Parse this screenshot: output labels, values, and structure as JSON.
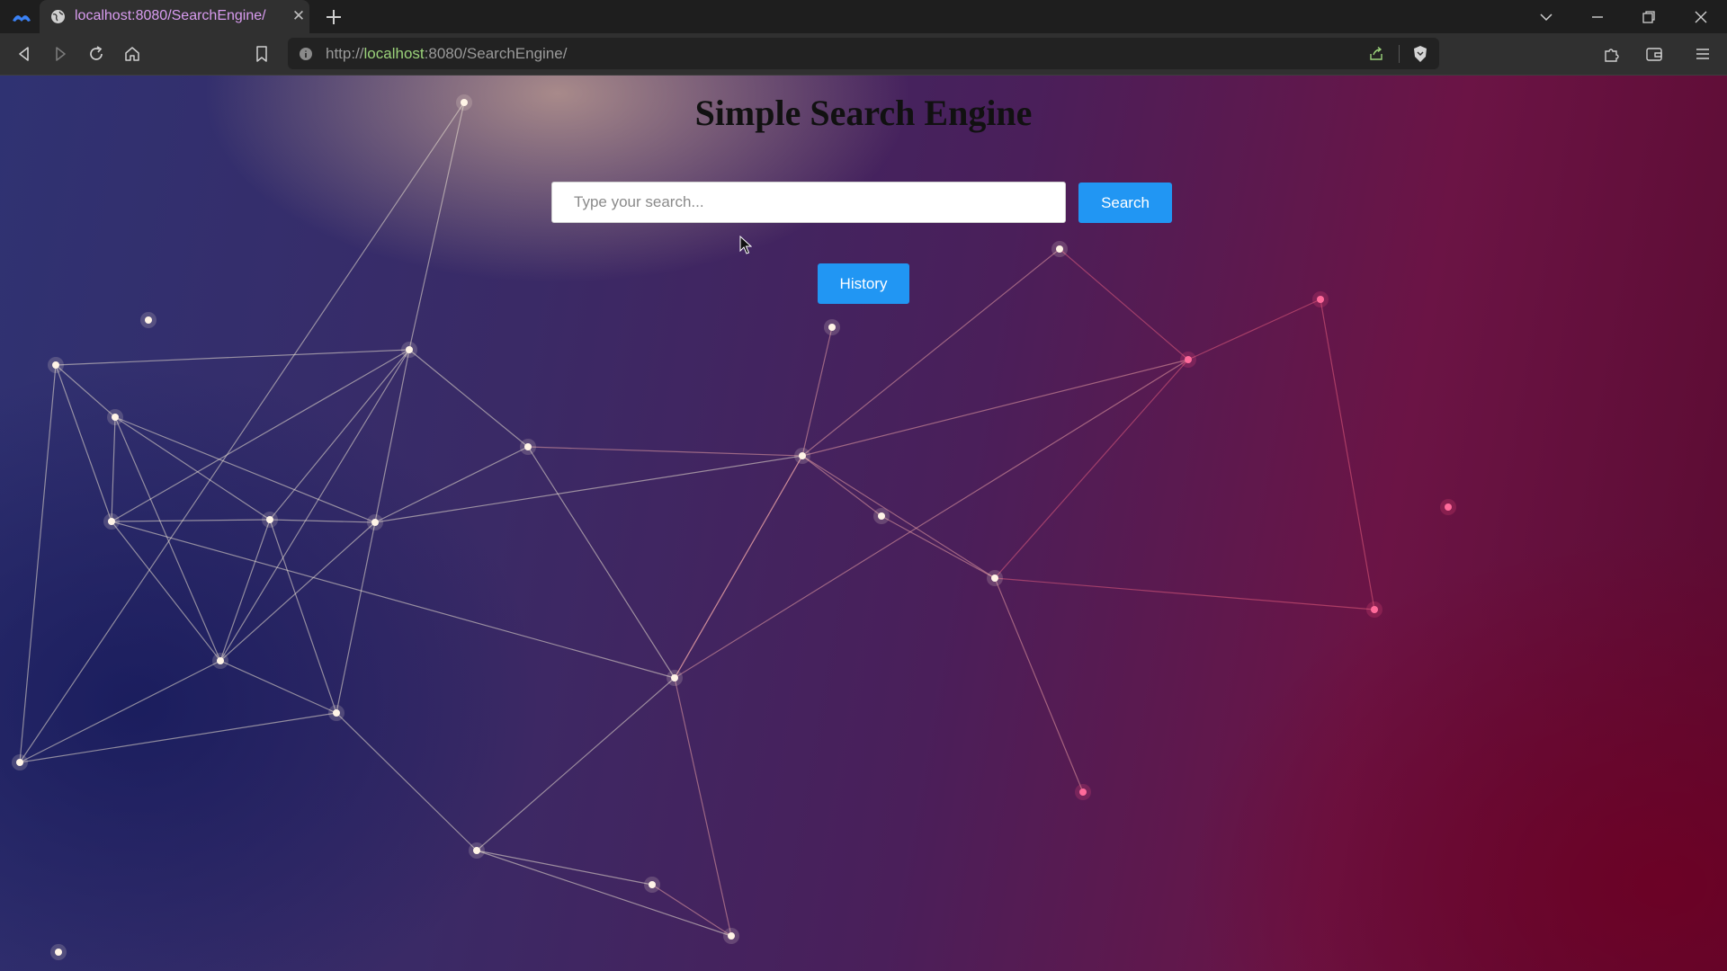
{
  "browser": {
    "tab_title": "localhost:8080/SearchEngine/",
    "url_prefix": "http://",
    "url_host": "localhost",
    "url_rest": ":8080/SearchEngine/",
    "icons": [
      "browser-logo-icon",
      "globe-icon",
      "close-icon",
      "plus-icon",
      "chevron-down-icon",
      "minimize-icon",
      "restore-icon",
      "close-window-icon",
      "back-icon",
      "forward-icon",
      "reload-icon",
      "home-icon",
      "bookmark-icon",
      "info-icon",
      "share-icon",
      "brave-shield-icon",
      "extensions-icon",
      "wallet-icon",
      "menu-icon"
    ]
  },
  "page": {
    "title": "Simple Search Engine",
    "search_placeholder": "Type your search...",
    "search_value": "",
    "search_button_label": "Search",
    "history_button_label": "History"
  },
  "colors": {
    "accent_button": "#2196f3",
    "tab_title": "#d99cf0",
    "url_host": "#9bd27a"
  }
}
